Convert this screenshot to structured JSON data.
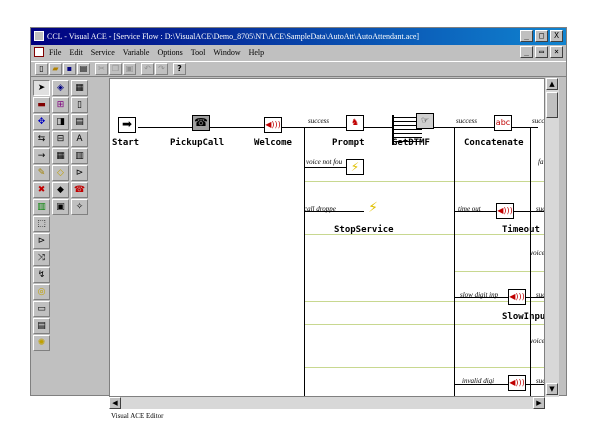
{
  "window": {
    "title": "CCL - Visual ACE - [Service Flow : D:\\VisualACE\\Demo_8705\\NT\\ACE\\SampleData\\AutoAtt\\AutoAttendant.ace]",
    "controls": [
      "_",
      "□",
      "X"
    ],
    "doc_controls": [
      "_",
      "▭",
      "×"
    ]
  },
  "menu": [
    "File",
    "Edit",
    "Service",
    "Variable",
    "Options",
    "Tool",
    "Window",
    "Help"
  ],
  "toolbar": {
    "help_label": "?"
  },
  "nodes": {
    "start": "Start",
    "pickupcall": "PickupCall",
    "welcome": "Welcome",
    "prompt": "Prompt",
    "getdtmf": "GetDTMF",
    "concatenate": "Concatenate",
    "stopservice": "StopService",
    "timeout": "Timeout",
    "slowinput": "SlowInput"
  },
  "edge_labels": {
    "success1": "success",
    "success2": "success",
    "success3": "succ",
    "voice_not_found": "voice not fou",
    "call_dropped": "call droppe",
    "time_out": "time out",
    "suc_timeout": "suc",
    "slow_digit_input": "slow digit inp",
    "suc_slow": "suc",
    "invalid_digit": "invalid digi",
    "suc_invalid": "suc",
    "fa": "fa",
    "voice_b1": "voice b",
    "voice_b2": "voice b"
  },
  "status": "Visual ACE Editor"
}
